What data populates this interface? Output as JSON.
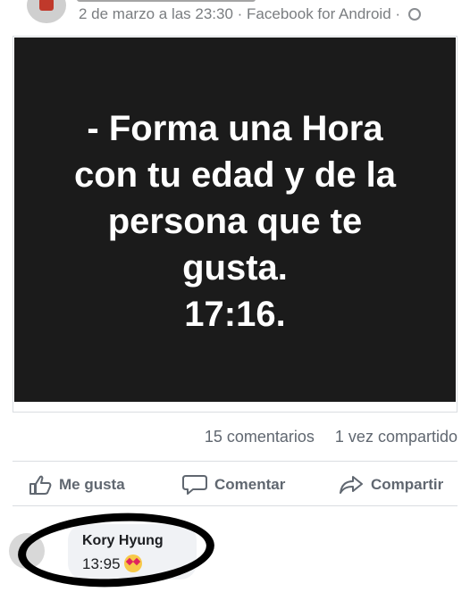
{
  "header": {
    "meta": "2 de marzo a las 23:30 · Facebook for Android ·",
    "privacy_icon": "globe-icon"
  },
  "post": {
    "lines": [
      "- Forma una Hora",
      "con tu edad y de la",
      "persona que te",
      "gusta.",
      "17:16."
    ]
  },
  "stats": {
    "comments": "15 comentarios",
    "shares": "1 vez compartido"
  },
  "actions": {
    "like": "Me gusta",
    "comment": "Comentar",
    "share": "Compartir"
  },
  "comment": {
    "author": "Kory Hyung",
    "text": "13:95",
    "emoji": "heart-eyes-emoji"
  },
  "colors": {
    "image_bg": "#1b1b1b",
    "meta_text": "#7a7d80",
    "action_text": "#606770",
    "bubble_bg": "#f0f2f5",
    "annotation_ring": "#000000"
  }
}
